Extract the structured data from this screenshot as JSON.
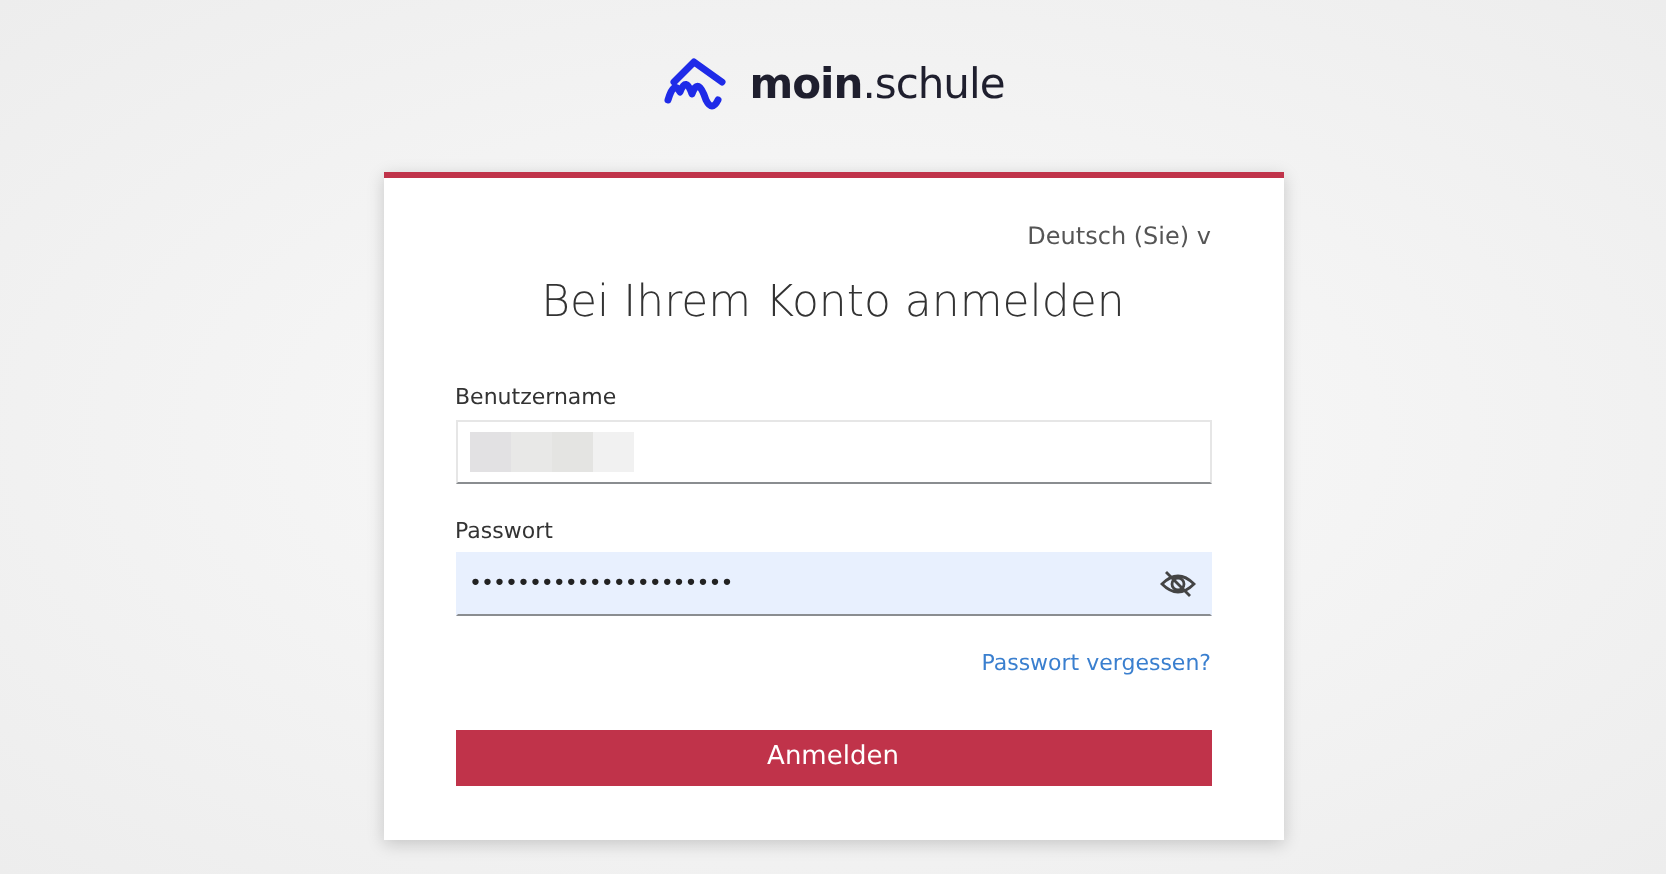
{
  "logo": {
    "text": "**moin**.schule"
  },
  "language": {
    "label": "Deutsch (Sie)",
    "caret": "v"
  },
  "title": "Bei Ihrem Konto anmelden",
  "username": {
    "label": "Benutzername",
    "redacted": true
  },
  "password": {
    "label": "Passwort",
    "value": "••••••••••••••••••••••",
    "autofilled": true
  },
  "forgot_link": "Passwort vergessen?",
  "submit": "Anmelden"
}
